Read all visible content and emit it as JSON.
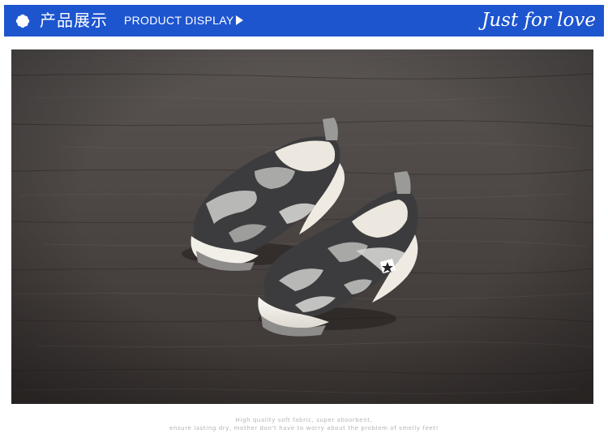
{
  "header": {
    "cn_title": "产品展示",
    "en_title": "PRODUCT DISPLAY",
    "tagline": "Just for love",
    "icon": "flower-icon",
    "arrow_icon": "play-arrow-icon",
    "background_color": "#1d55cf",
    "text_color": "#ffffff"
  },
  "product_photo": {
    "subject": "baby shoes",
    "label_text": "",
    "colors": {
      "wood": "#4a4442",
      "camo_dark": "#3c3c3e",
      "camo_light": "#b8b8b6",
      "sole": "#f2efe8"
    }
  },
  "caption": {
    "line1": "High quality soft fabric, super absorbent,",
    "line2": "ensure lasting dry, mother don't have to worry about the problem of smelly feet!"
  }
}
